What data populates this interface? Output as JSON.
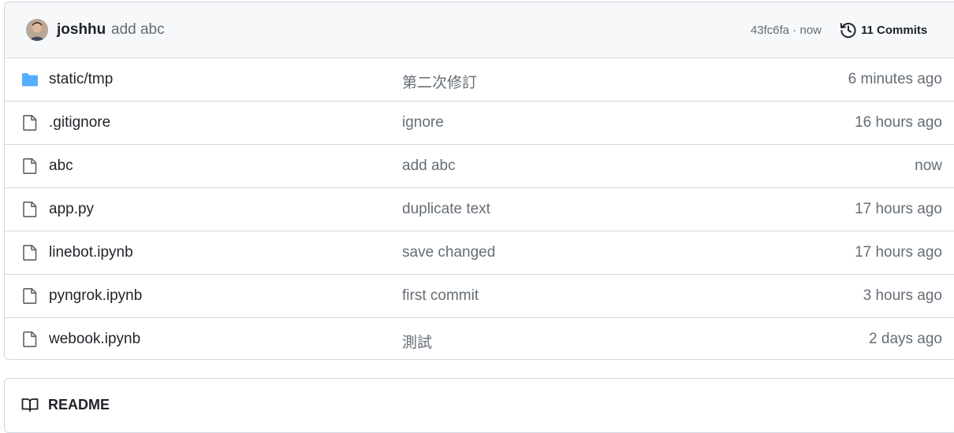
{
  "latest_commit": {
    "author": "joshhu",
    "message": "add abc",
    "meta": "43fc6fa · now",
    "commits_label": "11 Commits",
    "avatar_icon": "user-avatar",
    "history_icon": "history-icon"
  },
  "files": [
    {
      "type": "directory",
      "icon": "folder-icon",
      "name": "static/tmp",
      "commit": "第二次修訂",
      "time": "6 minutes ago"
    },
    {
      "type": "file",
      "icon": "file-icon",
      "name": ".gitignore",
      "commit": "ignore",
      "time": "16 hours ago"
    },
    {
      "type": "file",
      "icon": "file-icon",
      "name": "abc",
      "commit": "add abc",
      "time": "now"
    },
    {
      "type": "file",
      "icon": "file-icon",
      "name": "app.py",
      "commit": "duplicate text",
      "time": "17 hours ago"
    },
    {
      "type": "file",
      "icon": "file-icon",
      "name": "linebot.ipynb",
      "commit": "save changed",
      "time": "17 hours ago"
    },
    {
      "type": "file",
      "icon": "file-icon",
      "name": "pyngrok.ipynb",
      "commit": "first commit",
      "time": "3 hours ago"
    },
    {
      "type": "file",
      "icon": "file-icon",
      "name": "webook.ipynb",
      "commit": "測試",
      "time": "2 days ago"
    }
  ],
  "readme": {
    "title": "README",
    "icon": "book-icon"
  },
  "colors": {
    "folder": "#54aeff",
    "muted_text": "#656d76",
    "border": "#d0d7de",
    "header_bg": "#f6f8fa"
  }
}
